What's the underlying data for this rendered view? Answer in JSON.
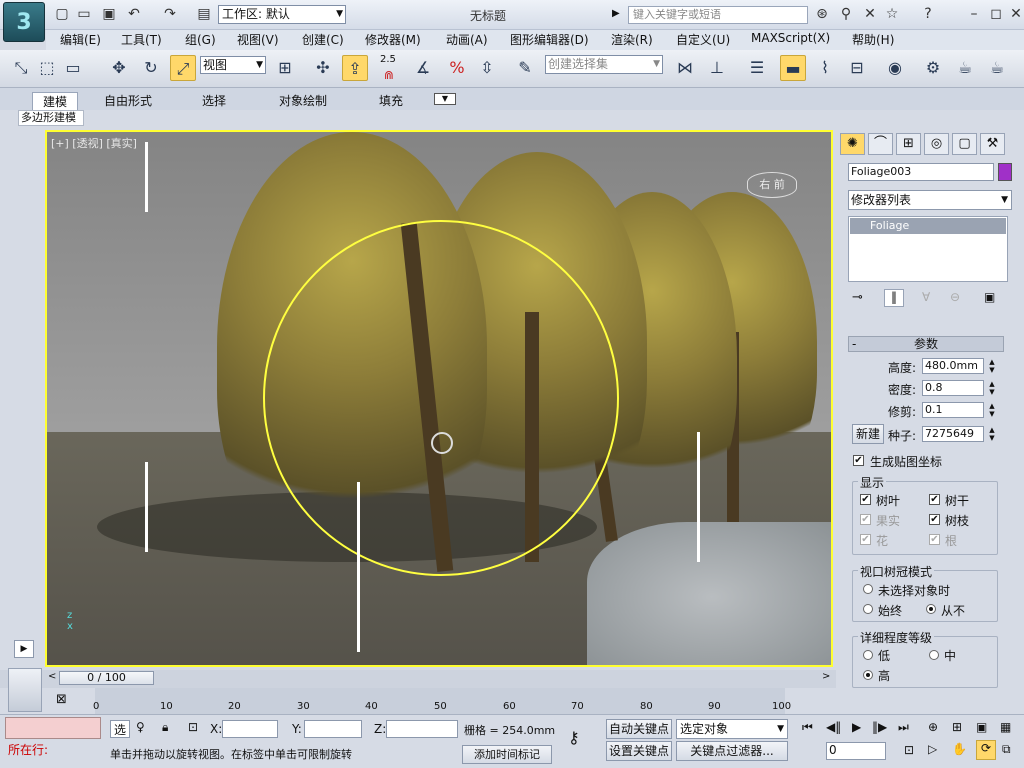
{
  "title_bar": {
    "workspace_label": "工作区: 默认",
    "window_title": "无标题",
    "search_placeholder": "键入关键字或短语"
  },
  "menu": {
    "items": [
      "编辑(E)",
      "工具(T)",
      "组(G)",
      "视图(V)",
      "创建(C)",
      "修改器(M)",
      "动画(A)",
      "图形编辑器(D)",
      "渲染(R)",
      "自定义(U)",
      "MAXScript(X)",
      "帮助(H)"
    ]
  },
  "main_toolbar": {
    "view_dropdown": "视图",
    "spinner_snap_value": "2.5",
    "selection_set_placeholder": "创建选择集"
  },
  "ribbon": {
    "tabs": [
      "建模",
      "自由形式",
      "选择",
      "对象绘制",
      "填充"
    ],
    "active_tab": "建模",
    "subpanel": "多边形建模"
  },
  "viewport": {
    "label": "[+] [透视] [真实]",
    "selection_color": "#ffff30"
  },
  "command_panel": {
    "object_name": "Foliage003",
    "object_color": "#a030c8",
    "modifier_list_label": "修改器列表",
    "stack_item": "Foliage",
    "params_title": "参数",
    "height_label": "高度:",
    "height_value": "480.0mm",
    "density_label": "密度:",
    "density_value": "0.8",
    "prune_label": "修剪:",
    "prune_value": "0.1",
    "new_button": "新建",
    "seed_label": "种子:",
    "seed_value": "7275649",
    "gen_mapping_label": "生成贴图坐标",
    "display_group": "显示",
    "display_items": [
      {
        "label": "树叶",
        "checked": "✔",
        "enabled": true
      },
      {
        "label": "树干",
        "checked": "✔",
        "enabled": true
      },
      {
        "label": "果实",
        "checked": "✔",
        "enabled": false
      },
      {
        "label": "树枝",
        "checked": "✔",
        "enabled": true
      },
      {
        "label": "花",
        "checked": "✔",
        "enabled": false
      },
      {
        "label": "根",
        "checked": "✔",
        "enabled": false
      }
    ],
    "canopy_group": "视口树冠模式",
    "canopy_options": [
      "未选择对象时",
      "始终",
      "从不"
    ],
    "canopy_selected": "从不",
    "lod_group": "详细程度等级",
    "lod_options": [
      "低",
      "中",
      "高"
    ],
    "lod_selected": "高"
  },
  "timeline": {
    "frame_display": "0 / 100",
    "ticks": [
      "0",
      "10",
      "20",
      "30",
      "40",
      "50",
      "60",
      "70",
      "80",
      "90",
      "100"
    ]
  },
  "status": {
    "running_label": "所在行:",
    "select_label": "选",
    "x_label": "X:",
    "y_label": "Y:",
    "z_label": "Z:",
    "grid_text": "栅格 = 254.0mm",
    "prompt_text": "单击并拖动以旋转视图。在标签中单击可限制旋转",
    "add_time_tag": "添加时间标记",
    "auto_key": "自动关键点",
    "set_key": "设置关键点",
    "key_mode_select": "选定对象",
    "key_filters": "关键点过滤器...",
    "current_frame": "0"
  }
}
